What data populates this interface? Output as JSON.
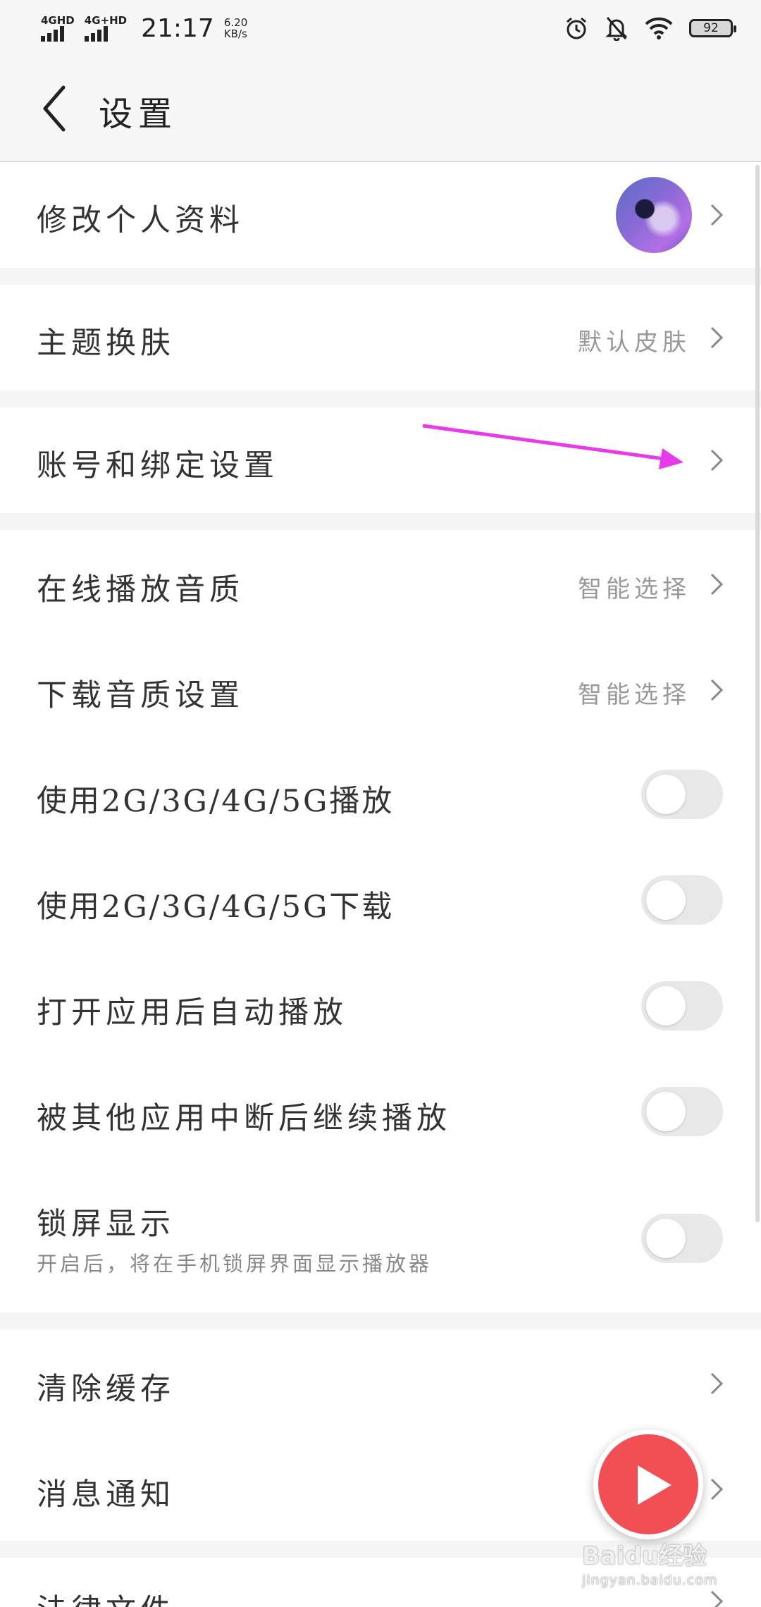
{
  "status_bar": {
    "signal1_label": "4GHD",
    "signal2_label": "4G+HD",
    "time": "21:17",
    "speed_value": "6.20",
    "speed_unit": "KB/s",
    "battery": "92"
  },
  "header": {
    "title": "设置"
  },
  "rows": {
    "profile": {
      "label": "修改个人资料"
    },
    "theme": {
      "label": "主题换肤",
      "value": "默认皮肤"
    },
    "account": {
      "label": "账号和绑定设置"
    },
    "online_quality": {
      "label": "在线播放音质",
      "value": "智能选择"
    },
    "download_quality": {
      "label": "下载音质设置",
      "value": "智能选择"
    },
    "mobile_play": {
      "label": "使用2G/3G/4G/5G播放",
      "checked": false
    },
    "mobile_download": {
      "label": "使用2G/3G/4G/5G下载",
      "checked": false
    },
    "autoplay": {
      "label": "打开应用后自动播放",
      "checked": false
    },
    "resume": {
      "label": "被其他应用中断后继续播放",
      "checked": false
    },
    "lockscreen": {
      "label": "锁屏显示",
      "sub": "开启后，将在手机锁屏界面显示播放器",
      "checked": false
    },
    "clear_cache": {
      "label": "清除缓存"
    },
    "notifications": {
      "label": "消息通知"
    },
    "legal": {
      "label": "法律文件"
    }
  },
  "annotation_color": "#e83ae8",
  "fab_color": "#f24f55",
  "watermark": {
    "brand": "Baidu经验",
    "url": "jingyan.baidu.com"
  }
}
